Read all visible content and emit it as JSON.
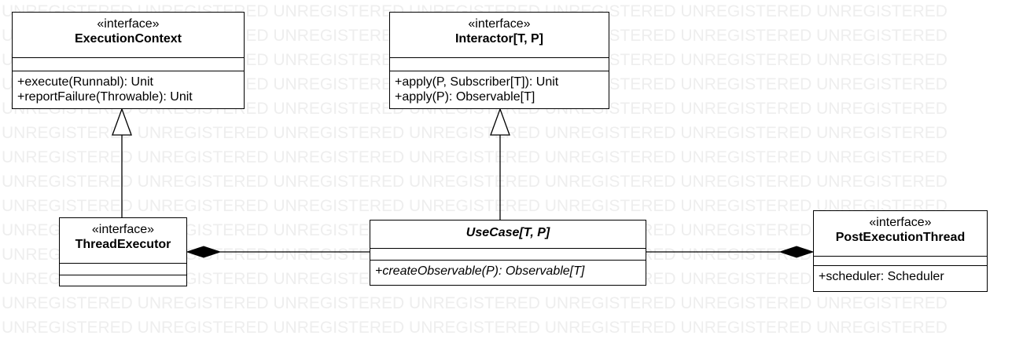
{
  "watermark_text": "UNREGISTERED UNREGISTERED UNREGISTERED UNREGISTERED UNREGISTERED UNREGISTERED UNREGISTERED",
  "classes": {
    "execution_context": {
      "stereotype": "«interface»",
      "name": "ExecutionContext",
      "attributes": [],
      "operations": [
        "+execute(Runnabl): Unit",
        "+reportFailure(Throwable): Unit"
      ]
    },
    "interactor": {
      "stereotype": "«interface»",
      "name": "Interactor[T, P]",
      "attributes": [],
      "operations": [
        "+apply(P, Subscriber[T]): Unit",
        "+apply(P): Observable[T]"
      ]
    },
    "thread_executor": {
      "stereotype": "«interface»",
      "name": "ThreadExecutor",
      "attributes": [],
      "operations": []
    },
    "use_case": {
      "stereotype": "",
      "name": "UseCase[T, P]",
      "abstract": true,
      "attributes": [],
      "operations": [
        "+createObservable(P): Observable[T]"
      ]
    },
    "post_execution_thread": {
      "stereotype": "«interface»",
      "name": "PostExecutionThread",
      "attributes": [],
      "operations": [
        "+scheduler: Scheduler"
      ]
    }
  },
  "relationships": [
    {
      "type": "realization",
      "from": "ThreadExecutor",
      "to": "ExecutionContext"
    },
    {
      "type": "realization",
      "from": "UseCase[T, P]",
      "to": "Interactor[T, P]"
    },
    {
      "type": "composition",
      "from": "UseCase[T, P]",
      "to": "ThreadExecutor"
    },
    {
      "type": "composition",
      "from": "UseCase[T, P]",
      "to": "PostExecutionThread"
    }
  ],
  "colors": {
    "stroke": "#000000",
    "fill": "#ffffff",
    "watermark": "#eeeeee"
  }
}
